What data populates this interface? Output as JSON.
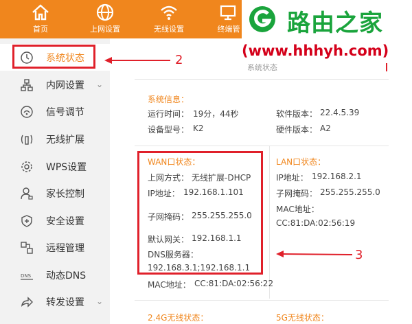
{
  "topnav": {
    "items": [
      {
        "label": "首页",
        "icon": "home-icon"
      },
      {
        "label": "上网设置",
        "icon": "globe-icon"
      },
      {
        "label": "无线设置",
        "icon": "wifi-icon"
      },
      {
        "label": "终端管",
        "icon": "monitor-icon"
      }
    ]
  },
  "watermark": {
    "brand": "路由之家",
    "url": "(www.hhhyh.com)"
  },
  "sidebar": {
    "items": [
      {
        "label": "系统状态",
        "icon": "clock-icon",
        "active": true
      },
      {
        "label": "内网设置",
        "icon": "network-icon",
        "expandable": true
      },
      {
        "label": "信号调节",
        "icon": "signal-icon"
      },
      {
        "label": "无线扩展",
        "icon": "antenna-icon"
      },
      {
        "label": "WPS设置",
        "icon": "gear-icon"
      },
      {
        "label": "家长控制",
        "icon": "user-icon"
      },
      {
        "label": "安全设置",
        "icon": "shield-icon"
      },
      {
        "label": "远程管理",
        "icon": "remote-icon"
      },
      {
        "label": "动态DNS",
        "icon": "dns-icon"
      },
      {
        "label": "转发设置",
        "icon": "forward-icon",
        "expandable": true
      }
    ]
  },
  "main": {
    "page_title": "系统状态",
    "system": {
      "title": "系统信息：",
      "uptime_label": "运行时间：",
      "uptime_value": "19分，44秒",
      "model_label": "设备型号：",
      "model_value": "K2",
      "software_label": "软件版本：",
      "software_value": "22.4.5.39",
      "hardware_label": "硬件版本：",
      "hardware_value": "A2"
    },
    "wan": {
      "title": "WAN口状态：",
      "mode_label": "上网方式：",
      "mode_value": "无线扩展-DHCP",
      "ip_label": "IP地址：",
      "ip_value": "192.168.1.101",
      "mask_label": "子网掩码：",
      "mask_value": "255.255.255.0",
      "gw_label": "默认网关：",
      "gw_value": "192.168.1.1",
      "dns_label": "DNS服务器：",
      "dns_value": "192.168.3.1;192.168.1.1",
      "mac_label": "MAC地址：",
      "mac_value": "CC:81:DA:02:56:22"
    },
    "lan": {
      "title": "LAN口状态：",
      "ip_label": "IP地址：",
      "ip_value": "192.168.2.1",
      "mask_label": "子网掩码：",
      "mask_value": "255.255.255.0",
      "mac_label": "MAC地址：",
      "mac_value": "CC:81:DA:02:56:19"
    },
    "wireless24_title": "2.4G无线状态：",
    "wireless5_title": "5G无线状态："
  },
  "annotations": {
    "n2": "2",
    "n3": "3"
  },
  "colors": {
    "accent": "#f0861d",
    "highlight": "#e0202a",
    "sidebar_bg": "#f2f2f2",
    "brand_green": "#1aa43c"
  }
}
